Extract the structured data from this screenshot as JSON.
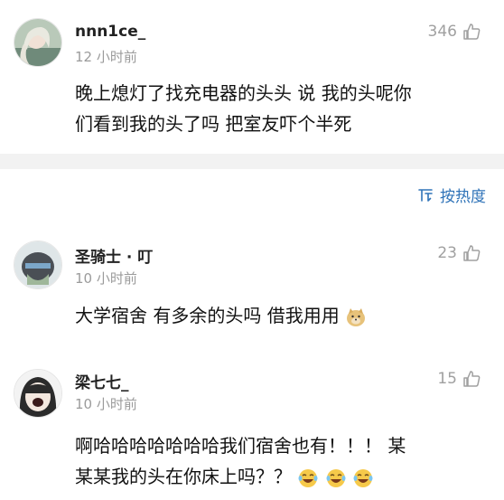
{
  "comments": [
    {
      "user": "nnn1ce_",
      "time": "12 小时前",
      "likes": "346",
      "text_lines": [
        "晚上熄灯了找充电器的头头 说 我的头呢你",
        "们看到我的头了吗 把室友吓个半死"
      ]
    },
    {
      "user": "圣骑士 · 叮",
      "time": "10 小时前",
      "likes": "23",
      "text": "大学宿舍 有多余的头吗 借我用用"
    },
    {
      "user": "梁七七_",
      "time": "10 小时前",
      "likes": "15",
      "text_lines": [
        "啊哈哈哈哈哈哈哈我们宿舍也有！！！ 某",
        "某某我的头在你床上吗？？"
      ]
    }
  ],
  "sort": {
    "label": "按热度",
    "icon": "sort-icon"
  },
  "icons": {
    "like": "thumbs-up-icon",
    "emoji_dog": "doge-emoji-icon",
    "emoji_laugh": "laughing-crying-emoji-icon"
  },
  "colors": {
    "accent": "#2f73b8",
    "muted": "#9b9b9b",
    "divider": "#f2f2f2"
  }
}
